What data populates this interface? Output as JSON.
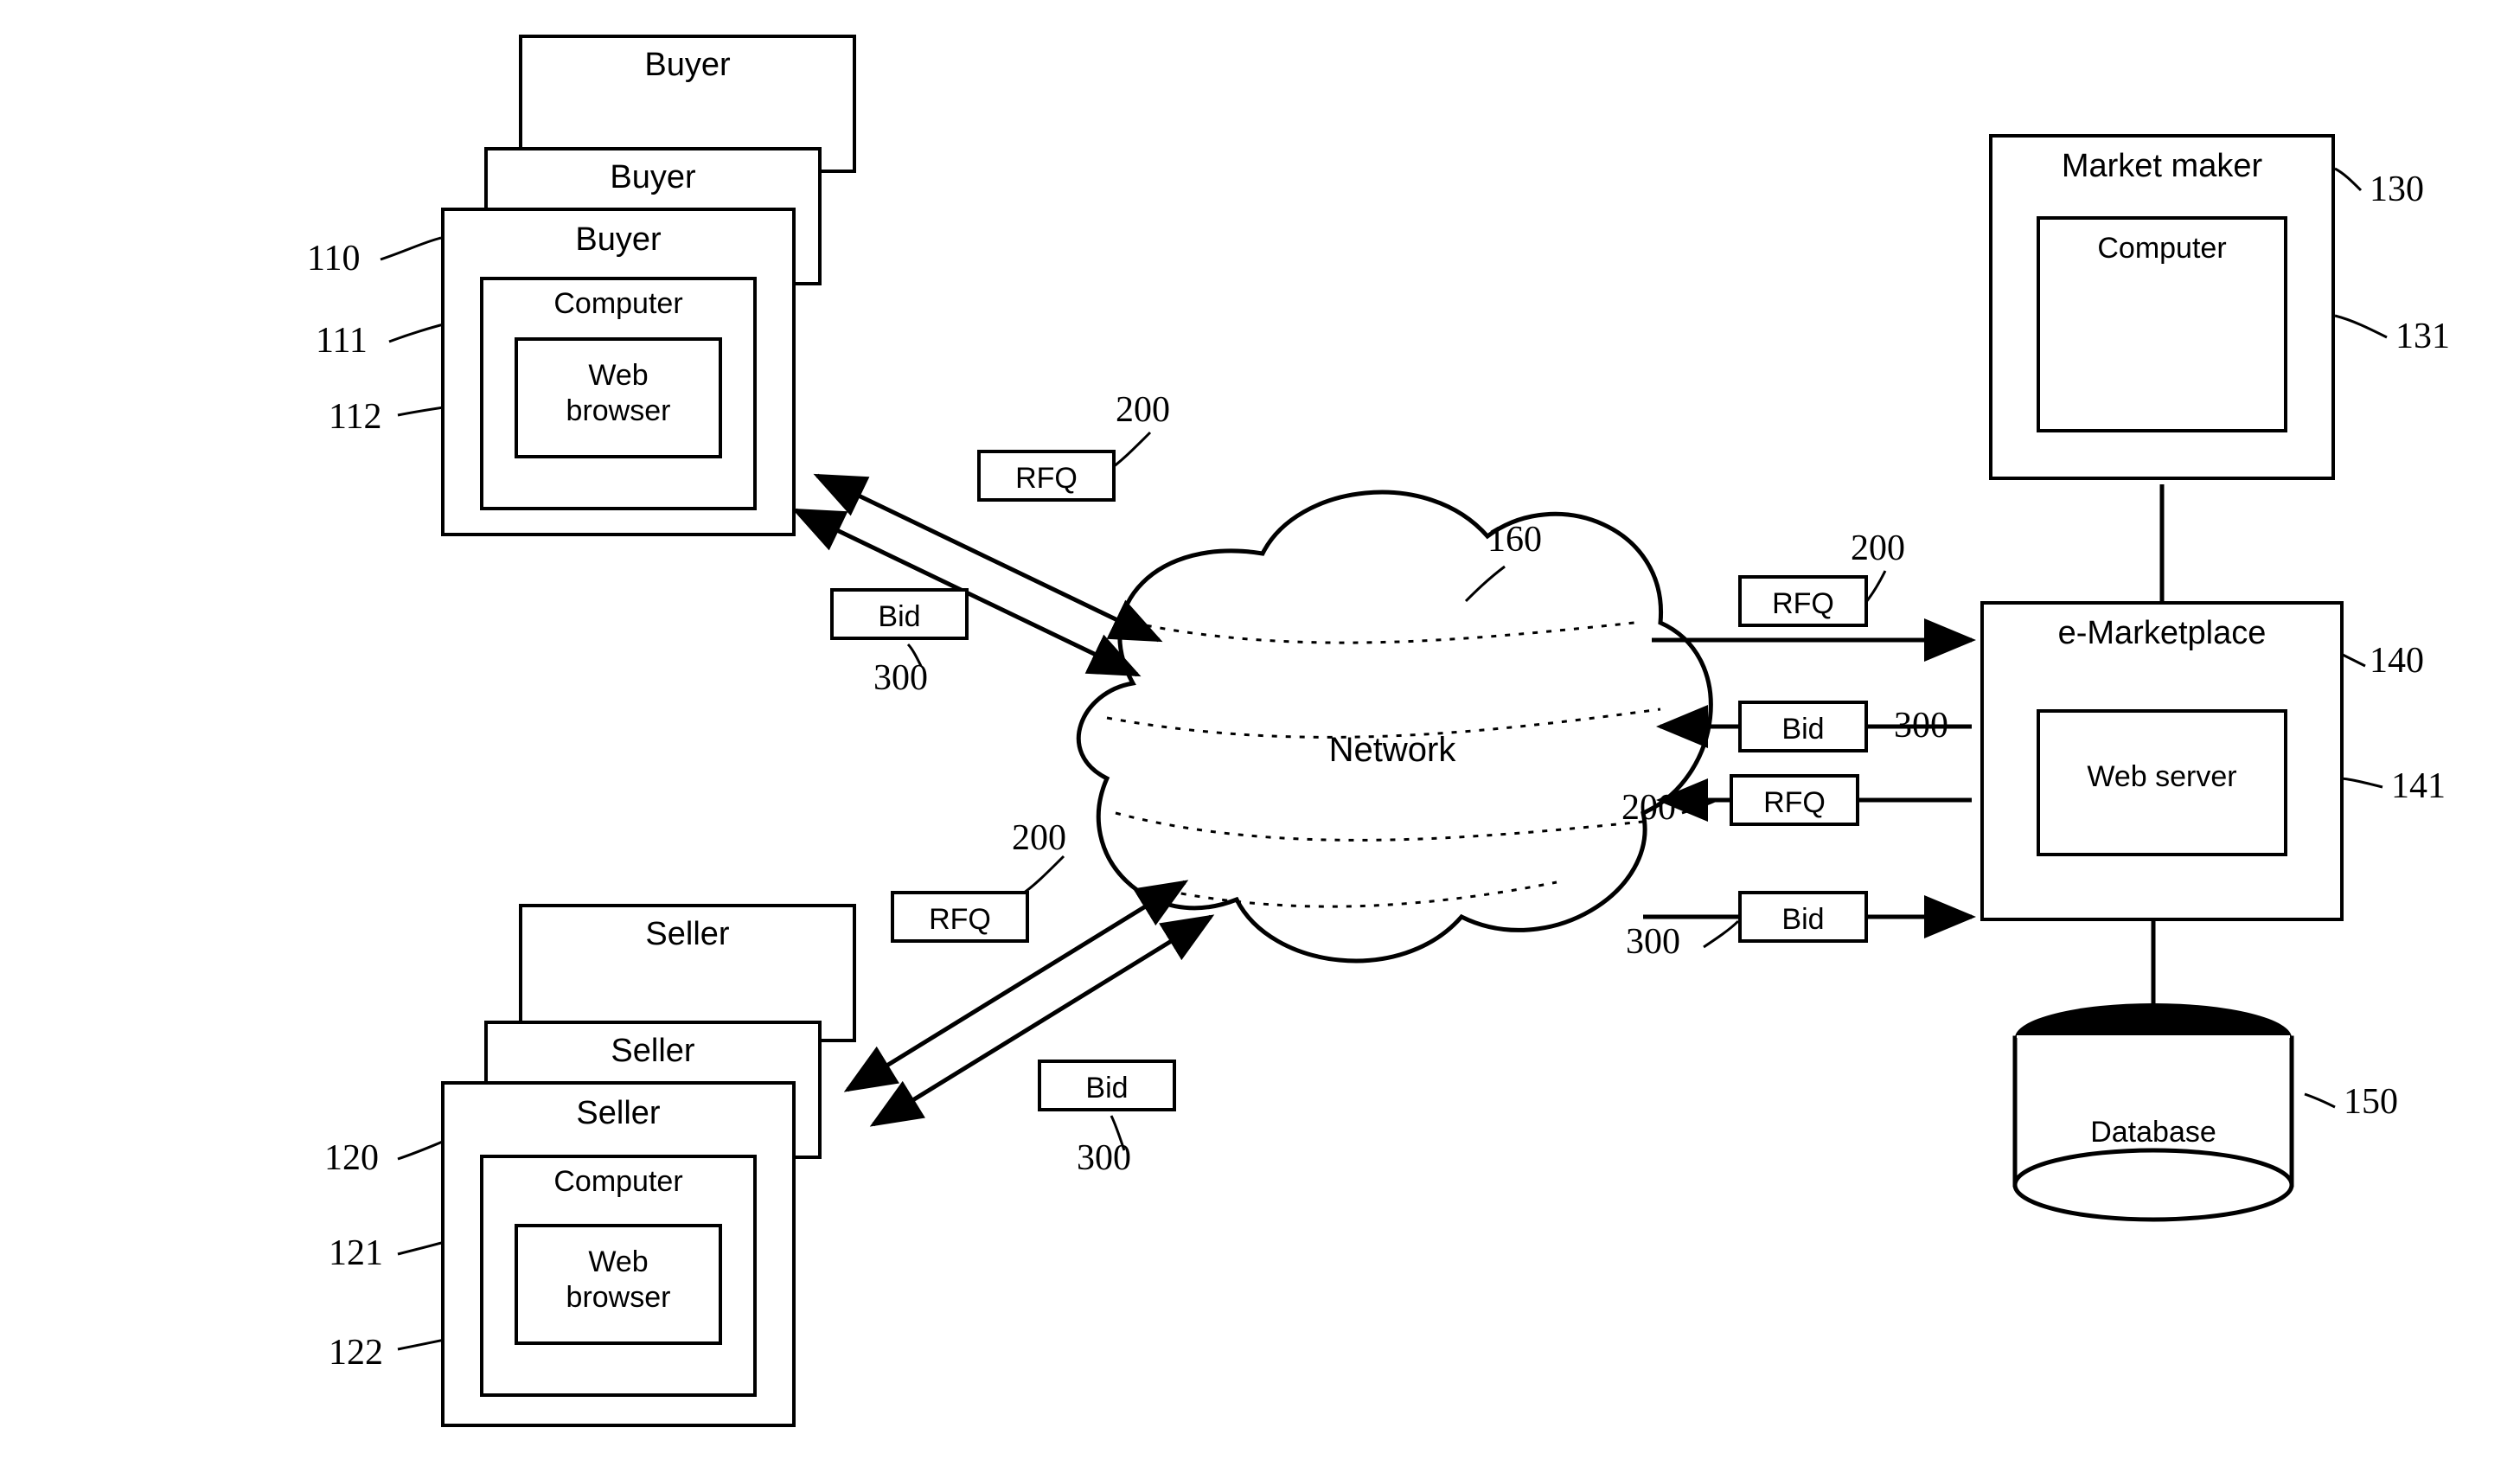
{
  "buyer": {
    "stack2": "Buyer",
    "stack1": "Buyer",
    "front": "Buyer",
    "computer": "Computer",
    "browser": "Web\nbrowser",
    "ref110": "110",
    "ref111": "111",
    "ref112": "112"
  },
  "seller": {
    "stack2": "Seller",
    "stack1": "Seller",
    "front": "Seller",
    "computer": "Computer",
    "browser": "Web\nbrowser",
    "ref120": "120",
    "ref121": "121",
    "ref122": "122"
  },
  "network": {
    "label": "Network",
    "ref160": "160"
  },
  "marketmaker": {
    "title": "Market maker",
    "computer": "Computer",
    "ref130": "130",
    "ref131": "131"
  },
  "emarket": {
    "title": "e-Marketplace",
    "web": "Web server",
    "ref140": "140",
    "ref141": "141"
  },
  "database": {
    "label": "Database",
    "ref150": "150"
  },
  "msgs": {
    "rfq": "RFQ",
    "bid": "Bid",
    "ref200": "200",
    "ref300": "300"
  }
}
